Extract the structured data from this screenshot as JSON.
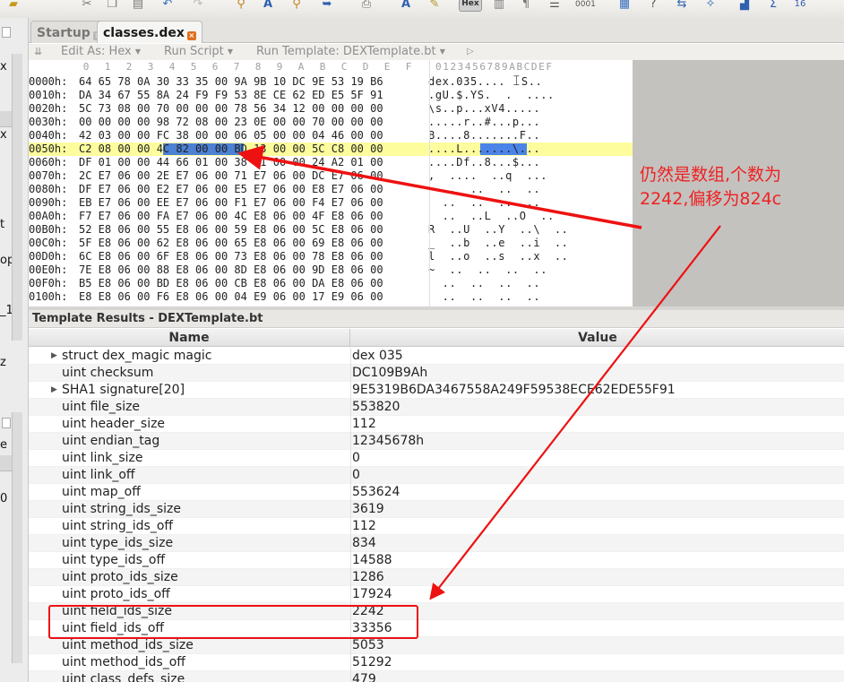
{
  "tabs": [
    {
      "label": "Startup",
      "active": false
    },
    {
      "label": "classes.dex",
      "active": true
    }
  ],
  "editor_bar": {
    "edit_as": "Edit As: Hex",
    "run_script": "Run Script",
    "run_template": "Run Template: DEXTemplate.bt"
  },
  "hex_columns": [
    "0",
    "1",
    "2",
    "3",
    "4",
    "5",
    "6",
    "7",
    "8",
    "9",
    "A",
    "B",
    "C",
    "D",
    "E",
    "F"
  ],
  "ascii_columns": "0123456789ABCDEF",
  "hex_rows": [
    {
      "addr": "0000h:",
      "bytes": "64 65 78 0A 30 33 35 00 9A 9B 10 DC 9E 53 19 B6",
      "ascii": "dex.035.... ꀤS.."
    },
    {
      "addr": "0010h:",
      "bytes": "DA 34 67 55 8A 24 F9 F9 53 8E CE 62 ED E5 5F 91",
      "ascii": ".gU.$.YS.  .  ...."
    },
    {
      "addr": "0020h:",
      "bytes": "5C 73 08 00 70 00 00 00 78 56 34 12 00 00 00 00",
      "ascii": "\\s..p...xV4....."
    },
    {
      "addr": "0030h:",
      "bytes": "00 00 00 00 98 72 08 00 23 0E 00 00 70 00 00 00",
      "ascii": ".....r..#...p..."
    },
    {
      "addr": "0040h:",
      "bytes": "42 03 00 00 FC 38 00 00 06 05 00 00 04 46 00 00",
      "ascii": "B....8.......F.."
    },
    {
      "addr": "0050h:",
      "bytes": "C2 08 00 00 4C 82 00 00 BD 13 00 00 5C C8 00 00",
      "ascii": "....L.......\\..."
    },
    {
      "addr": "0060h:",
      "bytes": "DF 01 00 00 44 66 01 00 38 B1 00 00 24 A2 01 00",
      "ascii": "....Df..8...$..."
    },
    {
      "addr": "0070h:",
      "bytes": "2C E7 06 00 2E E7 06 00 71 E7 06 00 DC E7 06 00",
      "ascii": ",  ....  ..q  ..."
    },
    {
      "addr": "0080h:",
      "bytes": "DF E7 06 00 E2 E7 06 00 E5 E7 06 00 E8 E7 06 00",
      "ascii": "  ..  ..  ..  .."
    },
    {
      "addr": "0090h:",
      "bytes": "EB E7 06 00 EE E7 06 00 F1 E7 06 00 F4 E7 06 00",
      "ascii": "  ..  ..  ..  .."
    },
    {
      "addr": "00A0h:",
      "bytes": "F7 E7 06 00 FA E7 06 00 4C E8 06 00 4F E8 06 00",
      "ascii": "  ..  ..L  ..O  .."
    },
    {
      "addr": "00B0h:",
      "bytes": "52 E8 06 00 55 E8 06 00 59 E8 06 00 5C E8 06 00",
      "ascii": "R  ..U  ..Y  ..\\  .."
    },
    {
      "addr": "00C0h:",
      "bytes": "5F E8 06 00 62 E8 06 00 65 E8 06 00 69 E8 06 00",
      "ascii": "_  ..b  ..e  ..i  .."
    },
    {
      "addr": "00D0h:",
      "bytes": "6C E8 06 00 6F E8 06 00 73 E8 06 00 78 E8 06 00",
      "ascii": "l  ..o  ..s  ..x  .."
    },
    {
      "addr": "00E0h:",
      "bytes": "7E E8 06 00 88 E8 06 00 8D E8 06 00 9D E8 06 00",
      "ascii": "~  ..  ..  ..  .."
    },
    {
      "addr": "00F0h:",
      "bytes": "B5 E8 06 00 BD E8 06 00 CB E8 06 00 DA E8 06 00",
      "ascii": "  ..  ..  ..  .."
    },
    {
      "addr": "0100h:",
      "bytes": "E8 E8 06 00 F6 E8 06 00 04 E9 06 00 17 E9 06 00",
      "ascii": "  ..  ..  ..  .."
    }
  ],
  "template": {
    "title": "Template Results - DEXTemplate.bt",
    "col_name": "Name",
    "col_value": "Value",
    "rows": [
      {
        "name": "struct dex_magic magic",
        "value": "dex 035",
        "expandable": true
      },
      {
        "name": "uint checksum",
        "value": "DC109B9Ah",
        "expandable": false
      },
      {
        "name": "SHA1 signature[20]",
        "value": "9E5319B6DA3467558A249F59538ECE62EDE55F91",
        "expandable": true
      },
      {
        "name": "uint file_size",
        "value": "553820",
        "expandable": false
      },
      {
        "name": "uint header_size",
        "value": "112",
        "expandable": false
      },
      {
        "name": "uint endian_tag",
        "value": "12345678h",
        "expandable": false
      },
      {
        "name": "uint link_size",
        "value": "0",
        "expandable": false
      },
      {
        "name": "uint link_off",
        "value": "0",
        "expandable": false
      },
      {
        "name": "uint map_off",
        "value": "553624",
        "expandable": false
      },
      {
        "name": "uint string_ids_size",
        "value": "3619",
        "expandable": false
      },
      {
        "name": "uint string_ids_off",
        "value": "112",
        "expandable": false
      },
      {
        "name": "uint type_ids_size",
        "value": "834",
        "expandable": false
      },
      {
        "name": "uint type_ids_off",
        "value": "14588",
        "expandable": false
      },
      {
        "name": "uint proto_ids_size",
        "value": "1286",
        "expandable": false
      },
      {
        "name": "uint proto_ids_off",
        "value": "17924",
        "expandable": false
      },
      {
        "name": "uint field_ids_size",
        "value": "2242",
        "expandable": false
      },
      {
        "name": "uint field_ids_off",
        "value": "33356",
        "expandable": false
      },
      {
        "name": "uint method_ids_size",
        "value": "5053",
        "expandable": false
      },
      {
        "name": "uint method_ids_off",
        "value": "51292",
        "expandable": false
      },
      {
        "name": "uint class_defs_size",
        "value": "479",
        "expandable": false
      }
    ]
  },
  "annotation": {
    "line1": "仍然是数组,个数为",
    "line2": "2242,偏移为824c",
    "color": "#ee2222"
  },
  "left_strip": {
    "glyphs": [
      "x",
      "x",
      "t",
      "op",
      "_1",
      "z",
      "e",
      "0"
    ]
  },
  "colors": {
    "highlight_row": "#fdfd9e",
    "selection": "#3873d8",
    "annotation_red": "#ee1111",
    "gray_area": "#c3c2bf"
  }
}
